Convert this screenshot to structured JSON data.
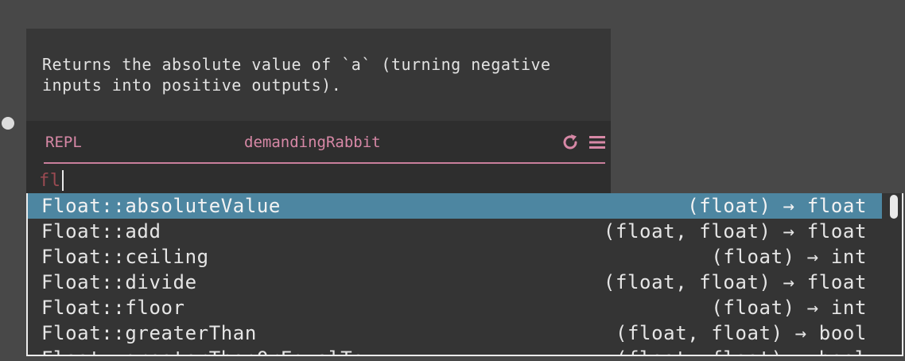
{
  "doc": {
    "text": "Returns the absolute value of `a` (turning negative\ninputs into positive outputs)."
  },
  "repl": {
    "label": "REPL",
    "handler_name": "demandingRabbit",
    "input_value": "fl",
    "refresh_icon": "refresh-icon",
    "menu_icon": "hamburger-menu-icon"
  },
  "autocomplete": {
    "selected_index": 0,
    "items": [
      {
        "name": "Float::absoluteValue",
        "signature": "(float) → float"
      },
      {
        "name": "Float::add",
        "signature": "(float, float) → float"
      },
      {
        "name": "Float::ceiling",
        "signature": "(float) → int"
      },
      {
        "name": "Float::divide",
        "signature": "(float, float) → float"
      },
      {
        "name": "Float::floor",
        "signature": "(float) → int"
      },
      {
        "name": "Float::greaterThan",
        "signature": "(float, float) → bool"
      },
      {
        "name": "Float::greaterThanOrEqualTo",
        "signature": "(float, float) → bool"
      }
    ]
  },
  "colors": {
    "background": "#484848",
    "accent_pink": "#d788a6",
    "selection_blue": "#4d86a1"
  }
}
